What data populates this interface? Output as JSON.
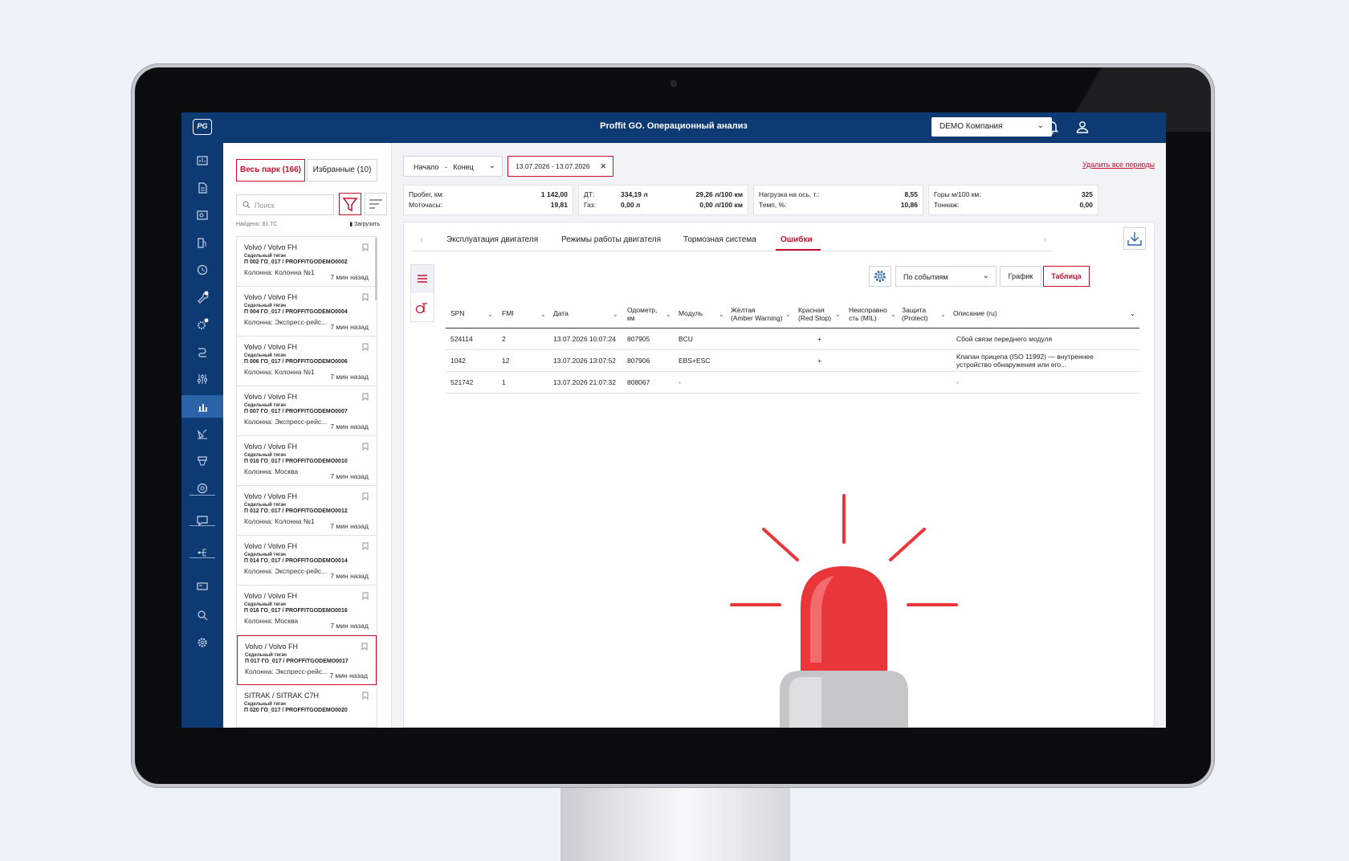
{
  "app": {
    "title": "Proffit GO. Операционный анализ",
    "logo": "PG",
    "company": "DEMO Компания"
  },
  "colors": {
    "navy": "#0d3a73",
    "accent": "#c8102e",
    "rail_active": "#2b63a9",
    "beacon": "#e8363a"
  },
  "rail": {
    "icons": [
      "dashboard-icon",
      "report-icon",
      "map-report-icon",
      "fuel-pump-icon",
      "clock-gauge-icon",
      "wrench-badge-icon",
      "gear-badge-icon",
      "route-icon",
      "sliders-icon",
      "analytics-icon",
      "satellite-icon",
      "lift-icon",
      "tire-icon",
      "chat-icon",
      "tree-icon",
      "card-icon",
      "search-doc-icon",
      "settings-icon"
    ],
    "active": "analytics-icon"
  },
  "fleet": {
    "tab_all": "Весь парк (166)",
    "tab_fav": "Избранные (10)",
    "search_placeholder": "Поиск",
    "found": "Найдено: 81 ТС",
    "load": "Загрузить",
    "vehicles": [
      {
        "name": "Volvo / Volvo FH",
        "type": "Седельный тягач",
        "plate": "П 002 ГО_017 / PROFFITGODEMO0002",
        "column": "Колонна: Колонна №1",
        "ago": "7 мин назад"
      },
      {
        "name": "Volvo / Volvo FH",
        "type": "Седельный тягач",
        "plate": "П 004 ГО_017 / PROFFITGODEMO0004",
        "column": "Колонна: Экспресс-рейс...",
        "ago": "7 мин назад"
      },
      {
        "name": "Volvo / Volvo FH",
        "type": "Седельный тягач",
        "plate": "П 006 ГО_017 / PROFFITGODEMO0006",
        "column": "Колонна: Колонна №1",
        "ago": "7 мин назад"
      },
      {
        "name": "Volvo / Volvo FH",
        "type": "Седельный тягач",
        "plate": "П 007 ГО_017 / PROFFITGODEMO0007",
        "column": "Колонна: Экспресс-рейс...",
        "ago": "7 мин назад"
      },
      {
        "name": "Volvo / Volvo FH",
        "type": "Седельный тягач",
        "plate": "П 010 ГО_017 / PROFFITGODEMO0010",
        "column": "Колонна: Москва",
        "ago": "7 мин назад"
      },
      {
        "name": "Volvo / Volvo FH",
        "type": "Седельный тягач",
        "plate": "П 012 ГО_017 / PROFFITGODEMO0012",
        "column": "Колонна: Колонна №1",
        "ago": "7 мин назад"
      },
      {
        "name": "Volvo / Volvo FH",
        "type": "Седельный тягач",
        "plate": "П 014 ГО_017 / PROFFITGODEMO0014",
        "column": "Колонна: Экспресс-рейс...",
        "ago": "7 мин назад"
      },
      {
        "name": "Volvo / Volvo FH",
        "type": "Седельный тягач",
        "plate": "П 016 ГО_017 / PROFFITGODEMO0016",
        "column": "Колонна: Москва",
        "ago": "7 мин назад"
      },
      {
        "name": "Volvo / Volvo FH",
        "type": "Седельный тягач",
        "plate": "П 017 ГО_017 / PROFFITGODEMO0017",
        "column": "Колонна: Экспресс-рейс...",
        "ago": "7 мин назад",
        "selected": true
      },
      {
        "name": "SITRAK / SITRAK C7H",
        "type": "Седельный тягач",
        "plate": "П 020 ГО_017 / PROFFITGODEMO0020",
        "column": "",
        "ago": ""
      }
    ]
  },
  "filters": {
    "start": "Начало",
    "dash": "-",
    "end": "Конец",
    "date_range": "13.07.2026 - 13.07.2026",
    "clear_all": "Удалить все периоды"
  },
  "stats": {
    "mileage_label": "Пробег, км:",
    "mileage_value": "1 142,00",
    "hours_label": "Моточасы:",
    "hours_value": "19,81",
    "dt_label": "ДТ:",
    "dt_value": "334,19 л",
    "dt_rate": "29,26 л/100 км",
    "gas_label": "Газ:",
    "gas_value": "0,00 л",
    "gas_rate": "0,00 л/100 км",
    "axle_label": "Нагрузка на ось, т.:",
    "axle_value": "8,55",
    "temp_label": "Темп, %:",
    "temp_value": "10,86",
    "mountains_label": "Горы м/100 км:",
    "mountains_value": "325",
    "tonnage_label": "Тоннаж:",
    "tonnage_value": "0,00"
  },
  "tabs": [
    "Эксплуатация двигателя",
    "Режимы работы двигателя",
    "Тормозная система",
    "Ошибки"
  ],
  "active_tab": "Ошибки",
  "controls": {
    "mode": "По событиям",
    "chart_btn": "График",
    "table_btn": "Таблица"
  },
  "table": {
    "headers": {
      "spn": "SPN",
      "fmi": "FMI",
      "date": "Дата",
      "odo1": "Одометр,",
      "odo2": "км",
      "module": "Модуль",
      "amber1": "Жёлтая",
      "amber2": "(Amber Warning)",
      "red1": "Красная",
      "red2": "(Red Stop)",
      "mil1": "Неисправно",
      "mil2": "сть (MIL)",
      "protect1": "Защита",
      "protect2": "(Protect)",
      "desc": "Описание (ru)"
    },
    "rows": [
      {
        "spn": "524114",
        "fmi": "2",
        "date": "13.07.2026 10:07:24",
        "odo": "807905",
        "module": "BCU",
        "amber": "",
        "red": "+",
        "mil": "",
        "protect": "",
        "desc1": "Сбой связи переднего модуля",
        "desc2": ""
      },
      {
        "spn": "1042",
        "fmi": "12",
        "date": "13.07.2026 13:07:52",
        "odo": "807906",
        "module": "EBS+ESC",
        "amber": "",
        "red": "+",
        "mil": "",
        "protect": "",
        "desc1": "Клапан прицепа (ISO 11992) — внутреннее",
        "desc2": "устройство обнаружения или его..."
      },
      {
        "spn": "521742",
        "fmi": "1",
        "date": "13.07.2026 21:07:32",
        "odo": "808067",
        "module": "-",
        "amber": "",
        "red": "",
        "mil": "",
        "protect": "",
        "desc1": "-",
        "desc2": ""
      }
    ]
  }
}
